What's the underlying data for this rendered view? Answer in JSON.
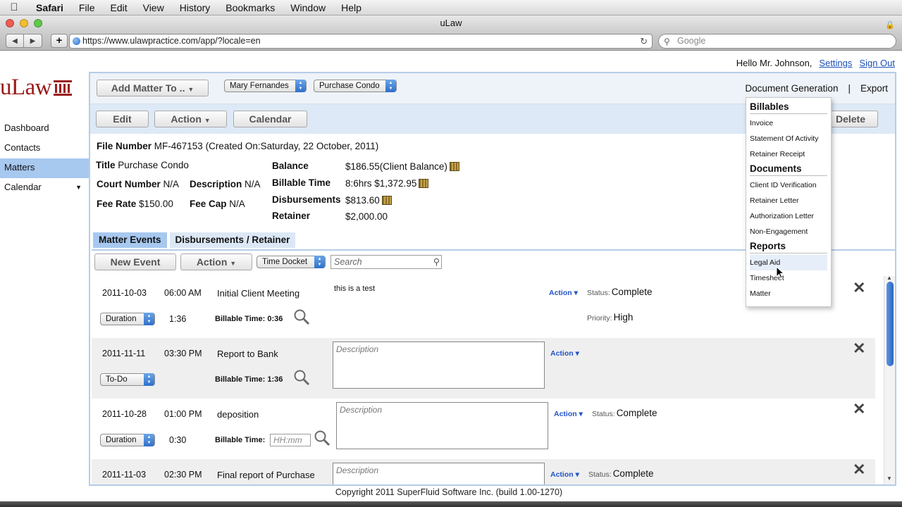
{
  "menubar": {
    "app_name": "Safari",
    "items": [
      "File",
      "Edit",
      "View",
      "History",
      "Bookmarks",
      "Window",
      "Help"
    ]
  },
  "window": {
    "title": "uLaw"
  },
  "browser": {
    "url": "https://www.ulawpractice.com/app/?locale=en",
    "search_placeholder": "Google"
  },
  "header": {
    "greeting": "Hello Mr. Johnson,",
    "settings_link": "Settings",
    "signout_link": "Sign Out"
  },
  "logo": {
    "text": "uLaw",
    "color": "#9b1b1b"
  },
  "sidebar": {
    "items": [
      {
        "label": "Dashboard"
      },
      {
        "label": "Contacts"
      },
      {
        "label": "Matters",
        "active": true
      },
      {
        "label": "Calendar"
      }
    ]
  },
  "topbar": {
    "add_matter_label": "Add Matter To ..",
    "client_select": "Mary Fernandes",
    "matter_select": "Purchase Condo",
    "document_generation": "Document Generation",
    "export": "Export"
  },
  "actions": {
    "edit": "Edit",
    "action": "Action",
    "calendar": "Calendar",
    "delete": "Delete"
  },
  "matter": {
    "file_number_label": "File Number",
    "file_number_value": "MF-467153 (Created On:Saturday, 22 October, 2011)",
    "title_label": "Title",
    "title_value": "Purchase Condo",
    "court_number_label": "Court Number",
    "court_number_value": "N/A",
    "description_label": "Description",
    "description_value": "N/A",
    "fee_rate_label": "Fee Rate",
    "fee_rate_value": "$150.00",
    "fee_cap_label": "Fee Cap",
    "fee_cap_value": "N/A",
    "balance_label": "Balance",
    "balance_value": "$186.55(Client Balance)",
    "billable_time_label": "Billable Time",
    "billable_time_value": "8:6hrs $1,372.95",
    "disbursements_label": "Disbursements",
    "disbursements_value": "$813.60",
    "retainer_label": "Retainer",
    "retainer_value": "$2,000.00"
  },
  "tabs": [
    {
      "label": "Matter Events",
      "active": true
    },
    {
      "label": "Disbursements / Retainer"
    }
  ],
  "events_toolbar": {
    "new_event": "New Event",
    "action": "Action",
    "filter_select": "Time Docket",
    "search_placeholder": "Search"
  },
  "events": [
    {
      "date": "2011-10-03",
      "time": "06:00 AM",
      "title": "Initial Client Meeting",
      "type_select": "Duration",
      "duration": "1:36",
      "billable_label": "Billable Time:",
      "billable_value": "0:36",
      "note": "this is a test",
      "action": "Action",
      "status_label": "Status:",
      "status_value": "Complete",
      "priority_label": "Priority:",
      "priority_value": "High"
    },
    {
      "date": "2011-11-11",
      "time": "03:30 PM",
      "title": "Report to Bank",
      "type_select": "To-Do",
      "duration": "",
      "billable_label": "Billable Time:",
      "billable_value": "1:36",
      "description_placeholder": "Description",
      "action": "Action"
    },
    {
      "date": "2011-10-28",
      "time": "01:00 PM",
      "title": "deposition",
      "type_select": "Duration",
      "duration": "0:30",
      "billable_label": "Billable Time:",
      "billable_input_placeholder": "HH:mm",
      "description_placeholder": "Description",
      "action": "Action",
      "status_label": "Status:",
      "status_value": "Complete"
    },
    {
      "date": "2011-11-03",
      "time": "02:30 PM",
      "title": "Final report of Purchase",
      "description_placeholder": "Description",
      "action": "Action",
      "status_label": "Status:",
      "status_value": "Complete"
    }
  ],
  "doc_menu": {
    "billables_header": "Billables",
    "billables": [
      "Invoice",
      "Statement Of Activity",
      "Retainer Receipt"
    ],
    "documents_header": "Documents",
    "documents": [
      "Client ID Verification",
      "Retainer Letter",
      "Authorization Letter",
      "Non-Engagement"
    ],
    "reports_header": "Reports",
    "reports": [
      "Legal Aid",
      "Timesheet",
      "Matter"
    ]
  },
  "footer": {
    "copyright": "Copyright 2011 SuperFluid Software Inc. (build 1.00-1270)"
  }
}
